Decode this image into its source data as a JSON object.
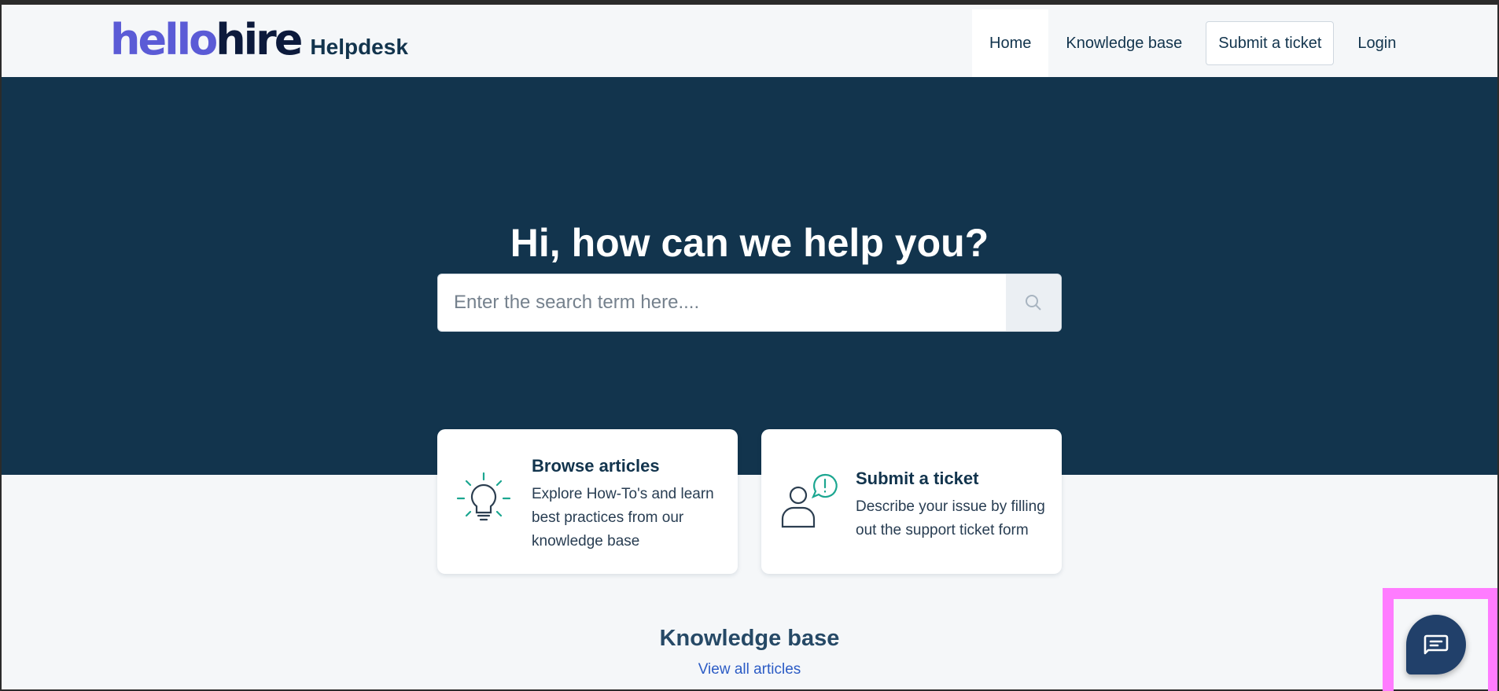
{
  "header": {
    "logo_part1": "hello",
    "logo_part2": "hire",
    "logo_sub": "Helpdesk",
    "nav": [
      "Home",
      "Knowledge base",
      "Submit a ticket",
      "Login"
    ]
  },
  "hero": {
    "title": "Hi, how can we help you?",
    "search_placeholder": "Enter the search term here...."
  },
  "cards": [
    {
      "title": "Browse articles",
      "description": "Explore How-To's and learn best practices from our knowledge base",
      "icon": "lightbulb-icon"
    },
    {
      "title": "Submit a ticket",
      "description": "Describe your issue by filling out the support ticket form",
      "icon": "user-alert-icon"
    }
  ],
  "knowledge_base": {
    "title": "Knowledge base",
    "link": "View all articles"
  },
  "colors": {
    "hero_bg": "#12344d",
    "accent_green": "#1ba690",
    "logo_purple": "#5b5bd6",
    "chat_bg": "#21406a",
    "highlight": "#ff7cff"
  }
}
